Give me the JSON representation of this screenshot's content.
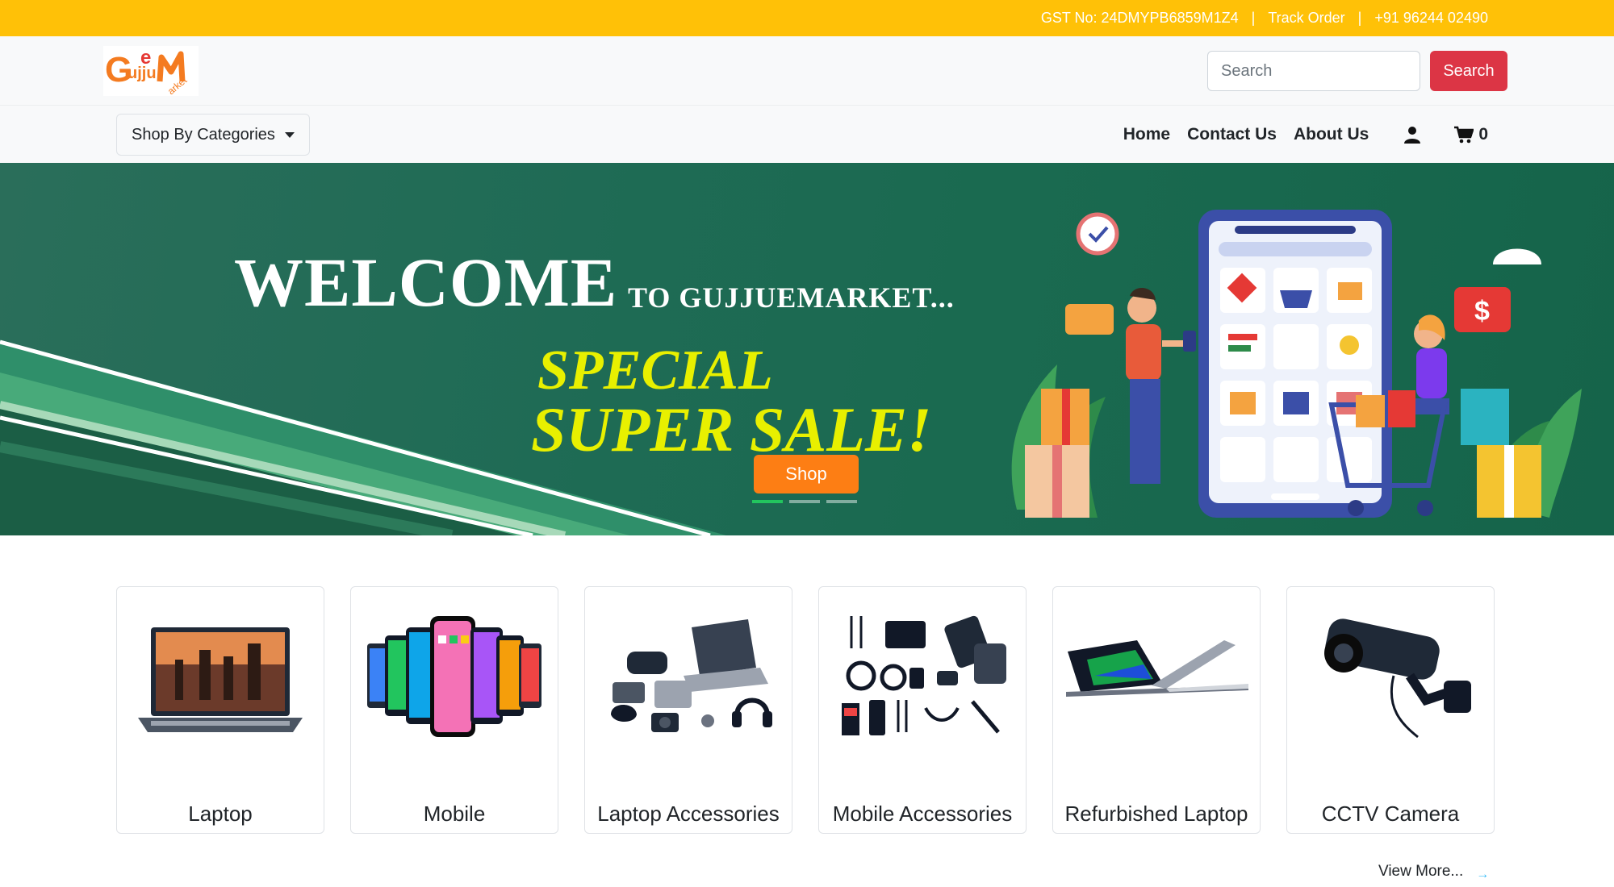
{
  "topbar": {
    "gst": "GST No: 24DMYPB6859M1Z4",
    "track_order": "Track Order",
    "phone": "+91 96244 02490",
    "separator": "|"
  },
  "header": {
    "logo_alt": "GujjueMarket",
    "search_placeholder": "Search",
    "search_button": "Search"
  },
  "nav": {
    "categories_button": "Shop By Categories",
    "links": [
      "Home",
      "Contact Us",
      "About Us"
    ],
    "cart_count": "0"
  },
  "hero": {
    "welcome": "WELCOME",
    "welcome_sub": "TO GUJJUEMARKET...",
    "special": "SPECIAL",
    "super_sale": "SUPER SALE!",
    "shop_button": "Shop",
    "slides": 3,
    "active_slide": 1
  },
  "categories": [
    {
      "label": "Laptop",
      "icon": "laptop-image"
    },
    {
      "label": "Mobile",
      "icon": "mobile-image"
    },
    {
      "label": "Laptop Accessories",
      "icon": "laptop-accessories-image"
    },
    {
      "label": "Mobile Accessories",
      "icon": "mobile-accessories-image"
    },
    {
      "label": "Refurbished Laptop",
      "icon": "refurbished-laptop-image"
    },
    {
      "label": "CCTV Camera",
      "icon": "cctv-camera-image"
    }
  ],
  "view_more": "View More...",
  "colors": {
    "topbar": "#ffc107",
    "search_button": "#dc3545",
    "shop_button": "#fd7e14",
    "hero_green": "#1f6b55",
    "sale_yellow": "#e8f000"
  }
}
